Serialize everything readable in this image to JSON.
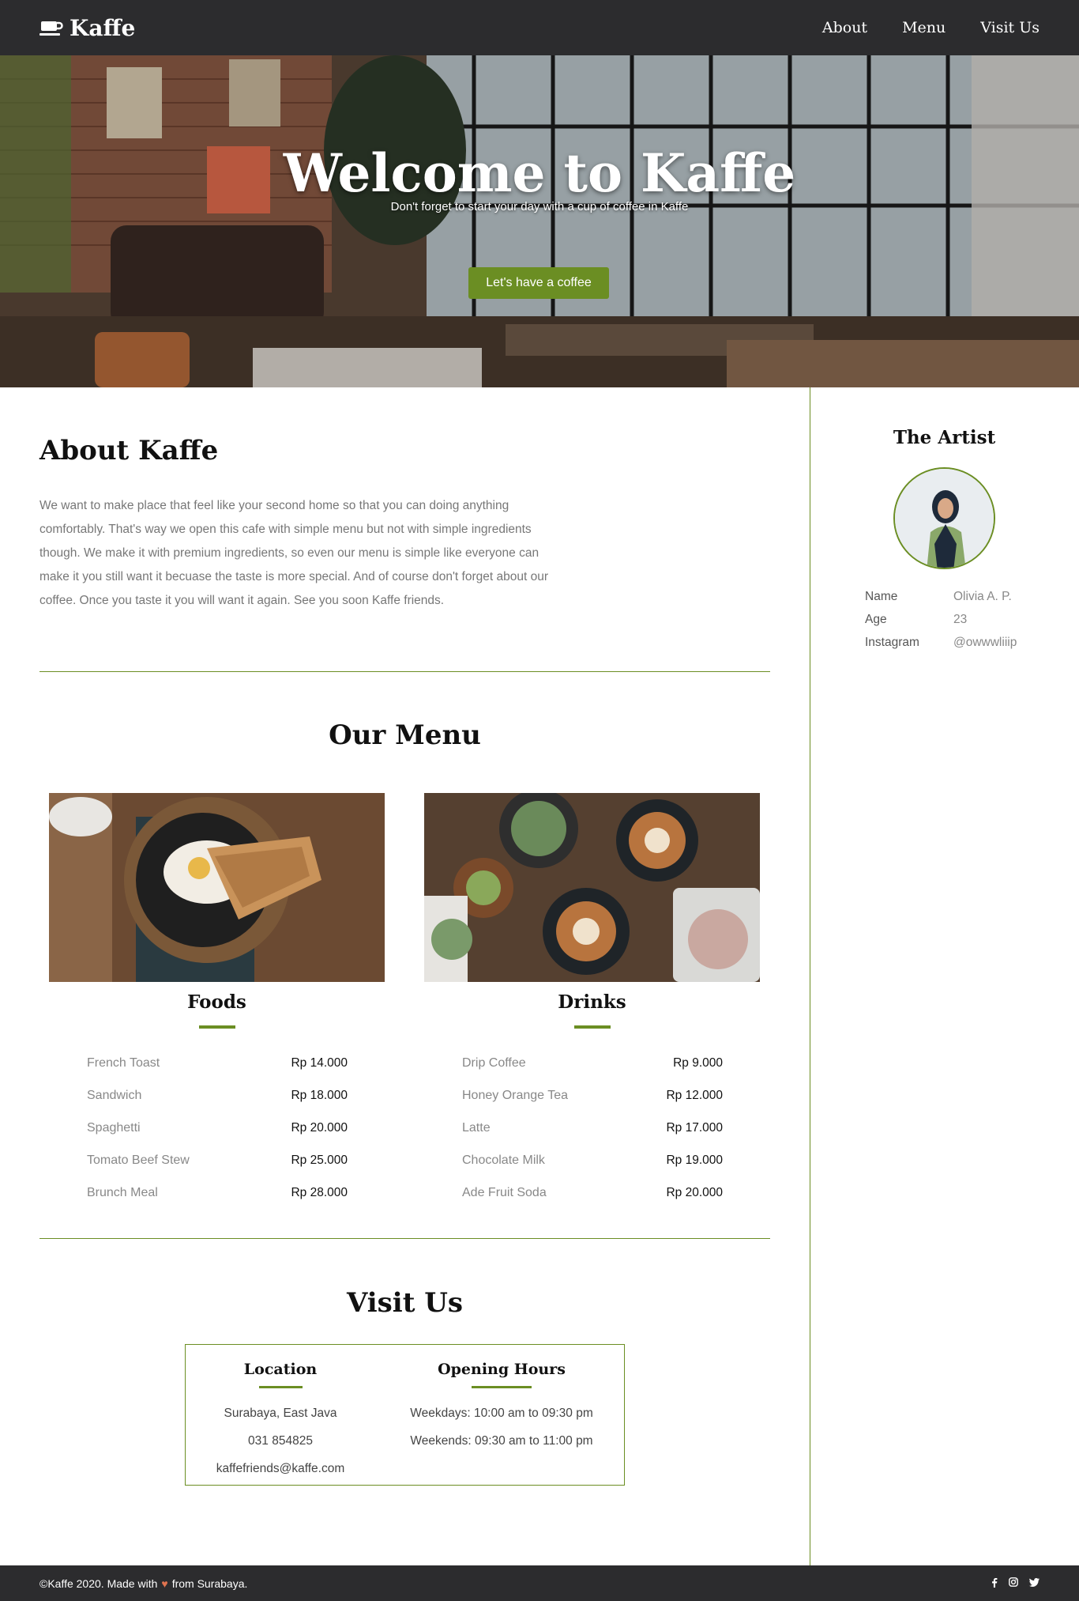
{
  "navbar": {
    "brand": "Kaffe",
    "brand_icon": "coffee-cup-icon",
    "links": [
      "About",
      "Menu",
      "Visit Us"
    ]
  },
  "hero": {
    "title": "Welcome to Kaffe",
    "subtitle": "Don't forget to start your day with a cup of coffee in Kaffe",
    "button": "Let's have a coffee",
    "accent": "#6b8e23"
  },
  "about": {
    "title": "About Kaffe",
    "text": "We want to make place that feel like your second home so that you can doing anything comfortably. That's way we open this cafe with simple menu but not with simple ingredients though. We make it with premium ingredients, so even our menu is simple like everyone can make it you still want it becuase the taste is more special. And of course don't forget about our coffee. Once you taste it you will want it again. See you soon Kaffe friends."
  },
  "menu": {
    "title": "Our Menu",
    "foods": {
      "label": "Foods",
      "items": [
        {
          "name": "French Toast",
          "price": "Rp 14.000"
        },
        {
          "name": "Sandwich",
          "price": "Rp 18.000"
        },
        {
          "name": "Spaghetti",
          "price": "Rp 20.000"
        },
        {
          "name": "Tomato Beef Stew",
          "price": "Rp 25.000"
        },
        {
          "name": "Brunch Meal",
          "price": "Rp 28.000"
        }
      ]
    },
    "drinks": {
      "label": "Drinks",
      "items": [
        {
          "name": "Drip Coffee",
          "price": "Rp 9.000"
        },
        {
          "name": "Honey Orange Tea",
          "price": "Rp 12.000"
        },
        {
          "name": "Latte",
          "price": "Rp 17.000"
        },
        {
          "name": "Chocolate Milk",
          "price": "Rp 19.000"
        },
        {
          "name": "Ade Fruit Soda",
          "price": "Rp 20.000"
        }
      ]
    }
  },
  "visit": {
    "title": "Visit Us",
    "location": {
      "label": "Location",
      "lines": [
        "Surabaya, East Java",
        "031 854825",
        "kaffefriends@kaffe.com"
      ]
    },
    "hours": {
      "label": "Opening Hours",
      "lines": [
        "Weekdays: 10:00 am to 09:30 pm",
        "Weekends: 09:30 am to 11:00 pm"
      ]
    }
  },
  "artist": {
    "title": "The Artist",
    "rows": [
      {
        "key": "Name",
        "value": "Olivia A. P."
      },
      {
        "key": "Age",
        "value": "23"
      },
      {
        "key": "Instagram",
        "value": "@owwwliiip"
      }
    ]
  },
  "footer": {
    "copy_before": "©Kaffe 2020. Made with",
    "heart": "♥",
    "copy_after": "from Surabaya.",
    "social": [
      "facebook-icon",
      "instagram-icon",
      "twitter-icon"
    ]
  }
}
